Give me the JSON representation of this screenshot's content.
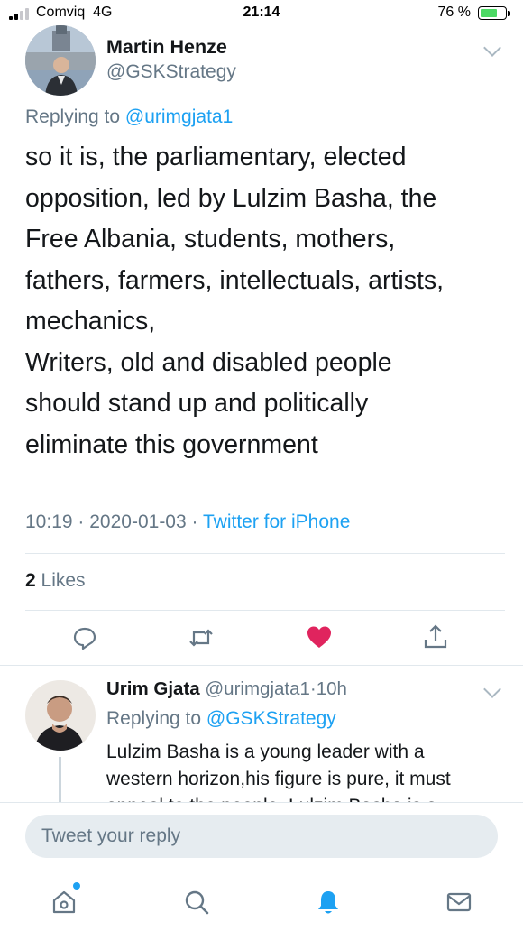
{
  "status_bar": {
    "carrier": "Comviq",
    "network": "4G",
    "time": "21:14",
    "battery": "76 %"
  },
  "tweet": {
    "author_name": "Martin Henze",
    "author_handle": "@GSKStrategy",
    "replying_prefix": "Replying to",
    "replying_handle": "@urimgjata1",
    "text": "so it is, the parliamentary, elected\nopposition, led by Lulzim Basha, the\nFree Albania, students, mothers,\nfathers, farmers, intellectuals, artists,\nmechanics,\nWriters, old and disabled people\nshould stand up and politically\neliminate this government",
    "time": "10:19",
    "date": "2020-01-03",
    "separator": "·",
    "source": "Twitter for iPhone",
    "likes_count": "2",
    "likes_label": "Likes"
  },
  "reply": {
    "author_name": "Urim Gjata",
    "author_handle": "@urimgjata1",
    "age": "10h",
    "separator": "·",
    "replying_prefix": "Replying to",
    "replying_handle": "@GSKStrategy",
    "text": "Lulzim Basha is a young leader with a\nwestern horizon,his figure is pure, it must\nappeal to the people. Lulzim Basha is a"
  },
  "composer": {
    "placeholder": "Tweet your reply"
  },
  "icons": {
    "reply": "reply-icon",
    "retweet": "retweet-icon",
    "like": "heart-icon",
    "share": "share-icon",
    "home": "home-icon",
    "search": "search-icon",
    "notifications": "bell-icon",
    "messages": "mail-icon"
  },
  "colors": {
    "accent": "#1da1f2",
    "like": "#e0245e",
    "muted": "#657786",
    "text": "#14171a"
  }
}
